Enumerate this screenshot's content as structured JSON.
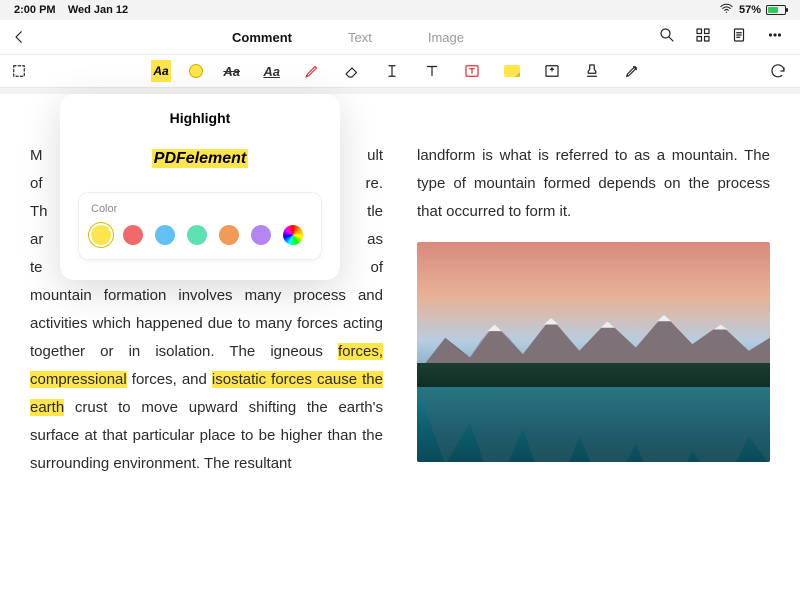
{
  "statusbar": {
    "time": "2:00 PM",
    "date": "Wed Jan 12",
    "battery": "57%"
  },
  "tabs": {
    "comment": "Comment",
    "text": "Text",
    "image": "Image"
  },
  "popover": {
    "title": "Highlight",
    "sample": "PDFelement",
    "color_label": "Color",
    "colors": [
      "#ffe54d",
      "#ef6b6b",
      "#62c1f0",
      "#5ee0b2",
      "#f09b5a",
      "#b486f2"
    ]
  },
  "document": {
    "left_pre": "M",
    "left_tail_1": "ult",
    "left_line2_pre": "of",
    "left_line2_tail": "re.",
    "left_line3_pre": "Th",
    "left_line3_tail": "tle",
    "left_line4_pre": "ar",
    "left_line4_tail": "as",
    "left_line5_pre": "te",
    "left_line5_tail": "of",
    "left_mid": " mountain formation involves many process and activities which happened due to many forces acting together or in isolation. The igneous ",
    "left_hl1": "forces, compressional",
    "left_mid2": " forces, and ",
    "left_hl2": "isostatic forces cause the earth",
    "left_end": " crust to move upward shifting the earth's surface at that particular place to be higher than the surrounding environment. The resultant",
    "right": "landform is what is referred to as a mountain. The type of mountain formed depends on the process that occurred to form it."
  }
}
